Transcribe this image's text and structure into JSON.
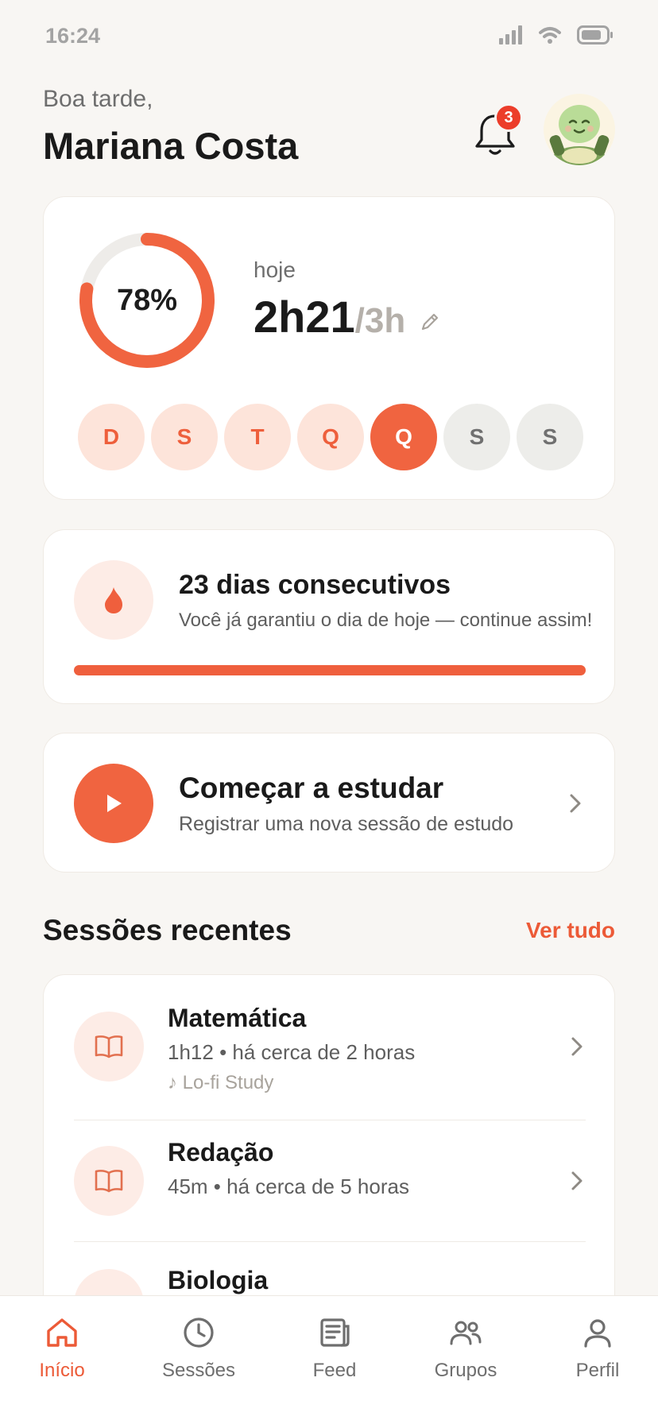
{
  "status_bar": {
    "time": "16:24"
  },
  "header": {
    "greeting": "Boa tarde,",
    "user_name": "Mariana Costa",
    "notification_count": "3"
  },
  "progress": {
    "percent_label": "78%",
    "percent": 78,
    "today_label": "hoje",
    "today_value": "2h21",
    "today_goal": "/3h",
    "week_days": [
      {
        "label": "D",
        "state": "done"
      },
      {
        "label": "S",
        "state": "done"
      },
      {
        "label": "T",
        "state": "done"
      },
      {
        "label": "Q",
        "state": "done"
      },
      {
        "label": "Q",
        "state": "today"
      },
      {
        "label": "S",
        "state": "future"
      },
      {
        "label": "S",
        "state": "future"
      }
    ]
  },
  "streak": {
    "title": "23 dias consecutivos",
    "subtitle": "Você já garantiu o dia de hoje — continue assim!",
    "progress_fraction": 1.0
  },
  "start_session": {
    "title": "Começar a estudar",
    "subtitle": "Registrar uma nova sessão de estudo"
  },
  "recent": {
    "title": "Sessões recentes",
    "see_all": "Ver tudo",
    "sessions": [
      {
        "title": "Matemática",
        "meta": "1h12 • há cerca de 2 horas",
        "music": "♪ Lo-fi Study"
      },
      {
        "title": "Redação",
        "meta": "45m • há cerca de 5 horas"
      },
      {
        "title": "Biologia"
      }
    ]
  },
  "nav": {
    "items": [
      {
        "label": "Início",
        "icon": "home-icon",
        "active": true
      },
      {
        "label": "Sessões",
        "icon": "clock-icon"
      },
      {
        "label": "Feed",
        "icon": "feed-icon"
      },
      {
        "label": "Grupos",
        "icon": "group-icon"
      },
      {
        "label": "Perfil",
        "icon": "profile-icon"
      }
    ]
  },
  "colors": {
    "accent": "#f06440",
    "accent_light": "#fde4da",
    "background": "#f8f6f3",
    "badge": "#ec3d2a"
  }
}
